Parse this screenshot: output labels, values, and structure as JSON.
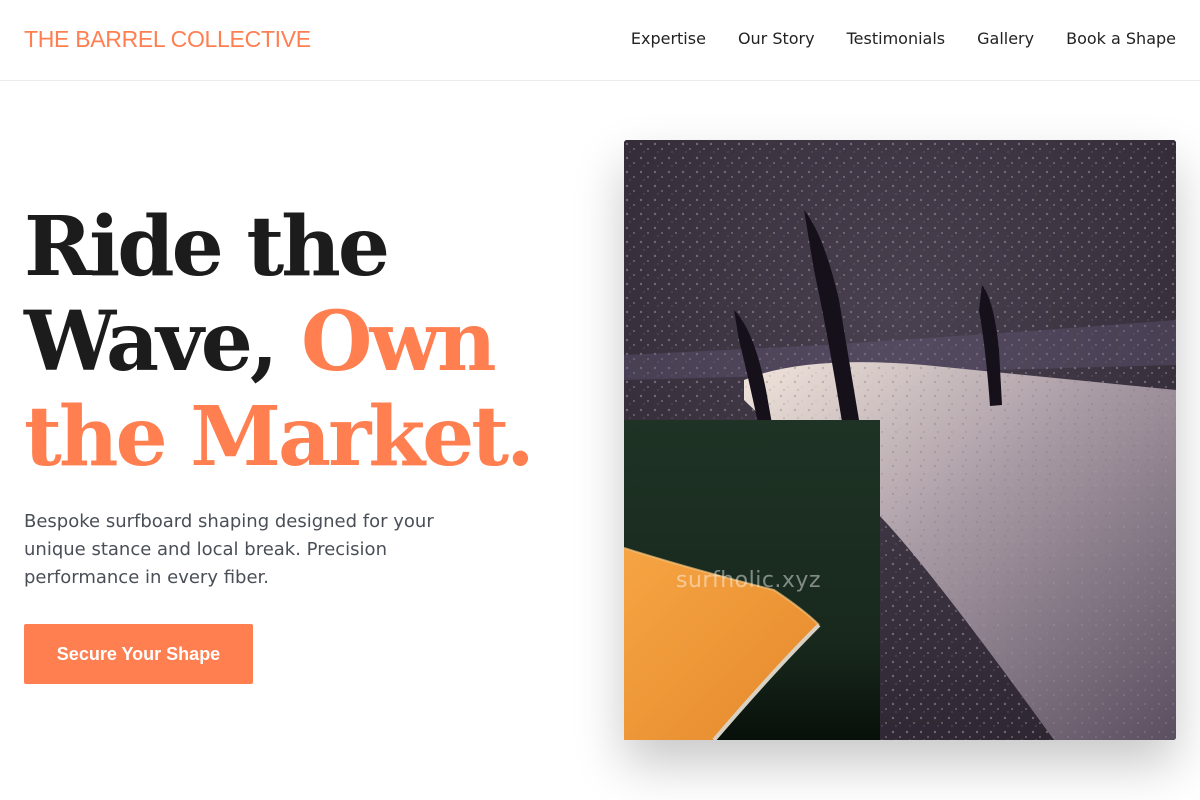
{
  "brand": {
    "name": "THE BARREL COLLECTIVE"
  },
  "nav": {
    "items": [
      {
        "label": "Expertise"
      },
      {
        "label": "Our Story"
      },
      {
        "label": "Testimonials"
      },
      {
        "label": "Gallery"
      },
      {
        "label": "Book a Shape"
      }
    ]
  },
  "hero": {
    "title_part1": "Ride the",
    "title_part2": "Wave,",
    "title_accent1": "Own",
    "title_accent2": "the Market.",
    "subtitle": "Bespoke surfboard shaping designed for your unique stance and local break. Precision performance in every fiber.",
    "cta_label": "Secure Your Shape"
  },
  "images": {
    "main": {
      "icon": "surfboard-fins-photo"
    },
    "inset": {
      "icon": "surfboard-nose-photo",
      "watermark": "surfholic.xyz"
    }
  },
  "colors": {
    "accent": "#ff7f50",
    "heading": "#1c1c1c",
    "body_text": "#4a4f57"
  }
}
